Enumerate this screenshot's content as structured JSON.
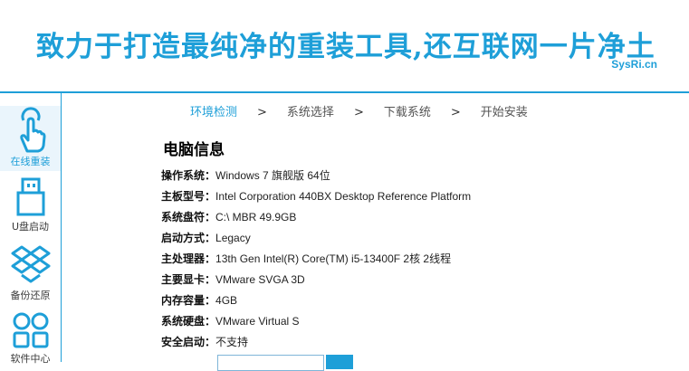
{
  "header": {
    "slogan": "致力于打造最纯净的重装工具,还互联网一片净土",
    "site": "SysRi.cn"
  },
  "sidebar": {
    "items": [
      {
        "label": "在线重装",
        "icon": "touch-hand-icon",
        "active": true
      },
      {
        "label": "U盘启动",
        "icon": "usb-drive-icon",
        "active": false
      },
      {
        "label": "备份还原",
        "icon": "dropbox-box-icon",
        "active": false
      },
      {
        "label": "软件中心",
        "icon": "apps-grid-icon",
        "active": false
      }
    ]
  },
  "steps": {
    "items": [
      "环境检测",
      "系统选择",
      "下载系统",
      "开始安装"
    ],
    "separator": ">",
    "active_index": 0
  },
  "main": {
    "section_title": "电脑信息",
    "rows": [
      {
        "key": "操作系统：",
        "value": "Windows 7 旗舰版  64位"
      },
      {
        "key": "主板型号：",
        "value": "Intel Corporation 440BX Desktop Reference Platform"
      },
      {
        "key": "系统盘符：",
        "value": "C:\\ MBR 49.9GB"
      },
      {
        "key": "启动方式：",
        "value": "Legacy"
      },
      {
        "key": "主处理器：",
        "value": "13th Gen Intel(R) Core(TM) i5-13400F 2核 2线程"
      },
      {
        "key": "主要显卡：",
        "value": "VMware SVGA 3D"
      },
      {
        "key": "内存容量：",
        "value": "4GB"
      },
      {
        "key": "系统硬盘：",
        "value": "VMware Virtual S"
      },
      {
        "key": "安全启动：",
        "value": "不支持"
      }
    ]
  },
  "colors": {
    "accent": "#1e9fd8",
    "text": "#111111"
  }
}
